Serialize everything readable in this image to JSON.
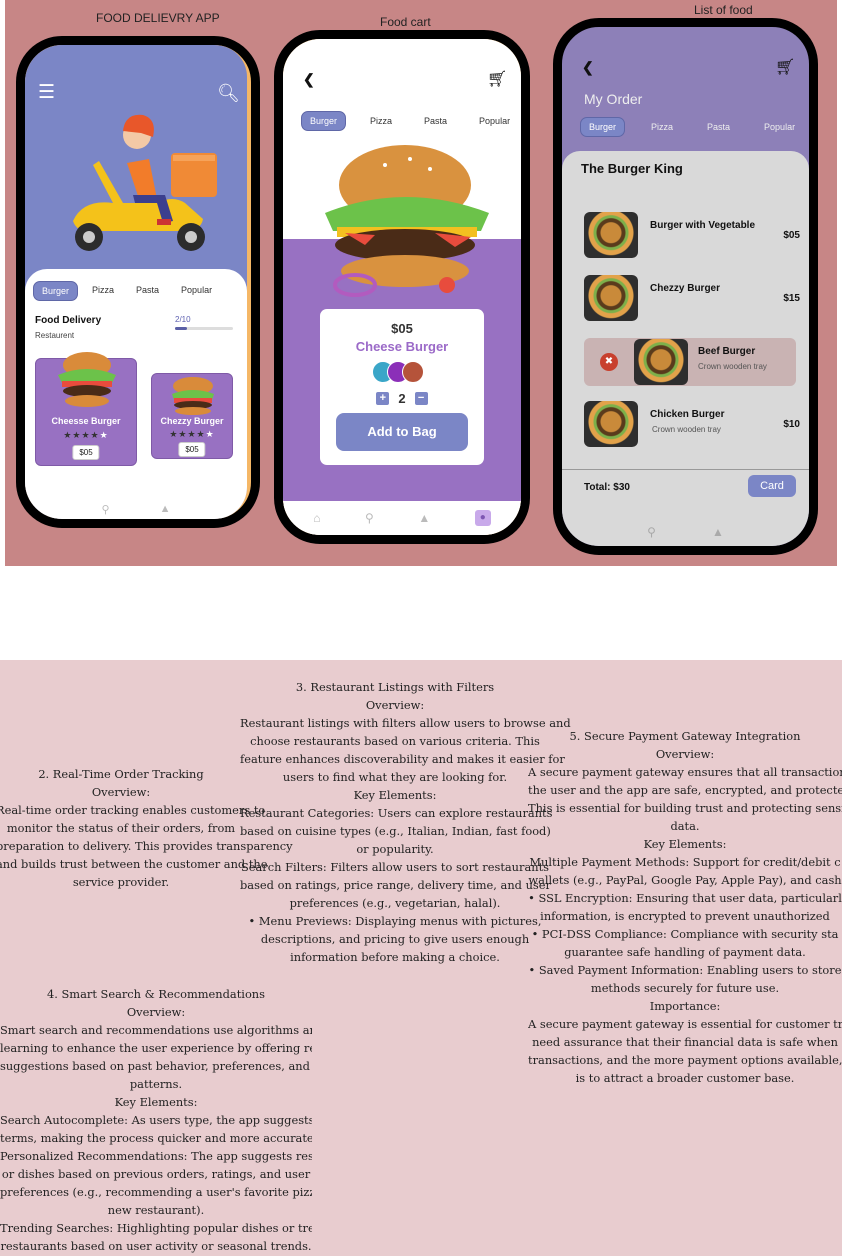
{
  "captions": {
    "app": "FOOD  DELIEVRY APP",
    "cart": "Food  cart",
    "list": "List of food"
  },
  "phone1": {
    "tabs": [
      "Burger",
      "Pizza",
      "Pasta",
      "Popular"
    ],
    "section_title": "Food Delivery",
    "section_subtitle": "Restaurent",
    "progress_text": "2/10",
    "progress_value": 0.2,
    "cards": [
      {
        "name": "Cheesse Burger",
        "price": "$05",
        "rating": 4
      },
      {
        "name": "Chezzy Burger",
        "price": "$05",
        "rating": 4
      }
    ]
  },
  "phone2": {
    "tabs": [
      "Burger",
      "Pizza",
      "Pasta",
      "Popular"
    ],
    "price": "$05",
    "name": "Cheese Burger",
    "quantity": "2",
    "add_button": "Add to Bag"
  },
  "phone3": {
    "title": "My Order",
    "tabs": [
      "Burger",
      "Pizza",
      "Pasta",
      "Popular"
    ],
    "restaurant": "The Burger King",
    "items": [
      {
        "name": "Burger  with Vegetable",
        "price": "$05"
      },
      {
        "name": "Chezzy Burger",
        "price": "$15"
      },
      {
        "name": "Beef Burger",
        "sub": "Crown wooden tray"
      },
      {
        "name": "Chicken Burger",
        "sub": "Crown wooden tray",
        "price": "$10"
      }
    ],
    "total": "Total: $30",
    "card_button": "Card"
  },
  "doc": {
    "sec2": [
      "2. Real-Time Order Tracking",
      "Overview:",
      "Real-time order tracking enables customers to",
      "monitor the status of their orders, from",
      "preparation to delivery. This provides transparency",
      "and builds trust between the customer and the",
      "service provider."
    ],
    "sec3": [
      "3. Restaurant Listings with Filters",
      "Overview:",
      "Restaurant listings with filters allow users to browse and",
      "choose restaurants based on various criteria. This",
      "feature enhances discoverability and makes it easier for",
      "users to find what they are looking for.",
      "Key Elements:",
      "Restaurant Categories: Users can explore restaurants",
      "based on cuisine types (e.g., Italian, Indian, fast food)",
      "or popularity.",
      "Search Filters: Filters allow users to sort restaurants",
      "based on ratings, price range, delivery time, and user",
      "preferences (e.g., vegetarian, halal).",
      "•  Menu Previews: Displaying menus with pictures,",
      "descriptions, and pricing to give users enough",
      "information before making a choice."
    ],
    "sec4": [
      "4. Smart Search & Recommendations",
      "Overview:",
      "Smart search and recommendations use algorithms and machine",
      "learning to enhance the user experience by offering relevant",
      "suggestions based on past behavior, preferences, and search",
      "patterns.",
      "Key Elements:",
      "Search Autocomplete: As users type, the app suggests search",
      "terms, making the process quicker and more accurate.",
      "Personalized Recommendations: The app suggests restaurants",
      "or dishes based on previous orders, ratings, and user",
      "preferences (e.g., recommending a user's favorite pizza place or",
      "new restaurant).",
      "Trending Searches: Highlighting popular dishes or trending",
      "restaurants based on user activity or seasonal trends."
    ],
    "sec5": [
      "5. Secure Payment Gateway Integration",
      "Overview:",
      "A secure payment gateway ensures that all transactions",
      "the user and the app are safe, encrypted, and protected",
      "This is essential for building trust and protecting sensiti",
      "data.",
      "Key Elements:",
      "Multiple Payment Methods: Support for credit/debit c",
      "wallets (e.g., PayPal, Google Pay, Apple Pay), and cash",
      "•  SSL Encryption: Ensuring that user data, particularl",
      "information, is encrypted to prevent unauthorized",
      "•  PCI-DSS Compliance: Compliance with security sta",
      "guarantee safe handling of payment data.",
      "•  Saved Payment Information: Enabling users to store",
      "methods securely for future use.",
      "Importance:",
      "A secure payment gateway is essential for customer tr",
      "need assurance that their financial data is safe when",
      "transactions, and the more payment options available, t",
      "is to attract a broader customer base."
    ]
  }
}
